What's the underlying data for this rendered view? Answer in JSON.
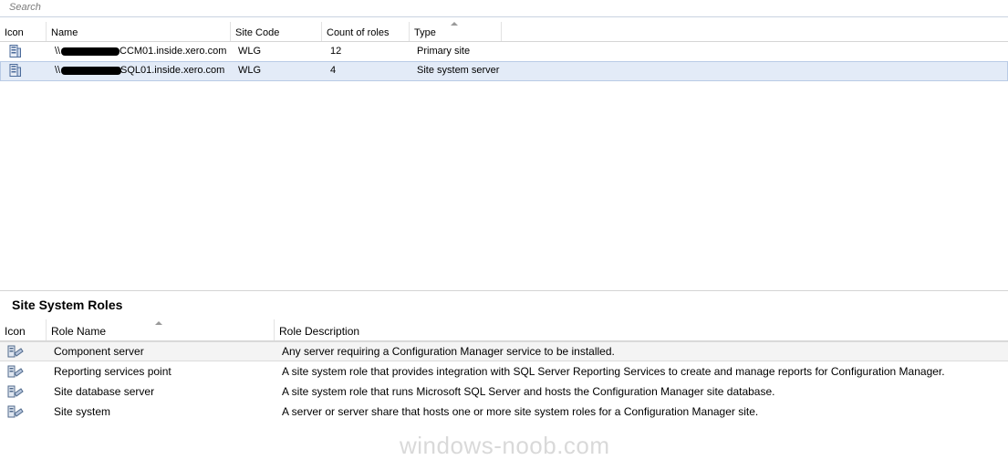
{
  "search": {
    "placeholder": "Search"
  },
  "servers_table": {
    "columns": [
      "Icon",
      "Name",
      "Site Code",
      "Count of roles",
      "Type"
    ],
    "rows": [
      {
        "name_prefix": "\\\\",
        "name_suffix": "CCM01.inside.xero.com",
        "site_code": "WLG",
        "count_of_roles": "12",
        "type": "Primary site",
        "icon": "server-icon"
      },
      {
        "name_prefix": "\\\\",
        "name_suffix": "SQL01.inside.xero.com",
        "site_code": "WLG",
        "count_of_roles": "4",
        "type": "Site system server",
        "icon": "server-icon"
      }
    ]
  },
  "roles_section": {
    "title": "Site System Roles",
    "columns": [
      "Icon",
      "Role Name",
      "Role Description"
    ],
    "rows": [
      {
        "name": "Component server",
        "description": "Any server requiring a Configuration Manager service to be installed.",
        "icon": "site-role-icon"
      },
      {
        "name": "Reporting services point",
        "description": "A site system role that  provides integration with SQL Server Reporting Services to create and manage reports for Configuration Manager.",
        "icon": "site-role-icon"
      },
      {
        "name": "Site database server",
        "description": "A site system role that runs Microsoft SQL Server and hosts the Configuration Manager site database.",
        "icon": "site-role-icon"
      },
      {
        "name": "Site system",
        "description": "A server or server share that hosts one or more site system roles for a Configuration Manager site.",
        "icon": "site-role-icon"
      }
    ]
  },
  "watermark": "windows-noob.com"
}
